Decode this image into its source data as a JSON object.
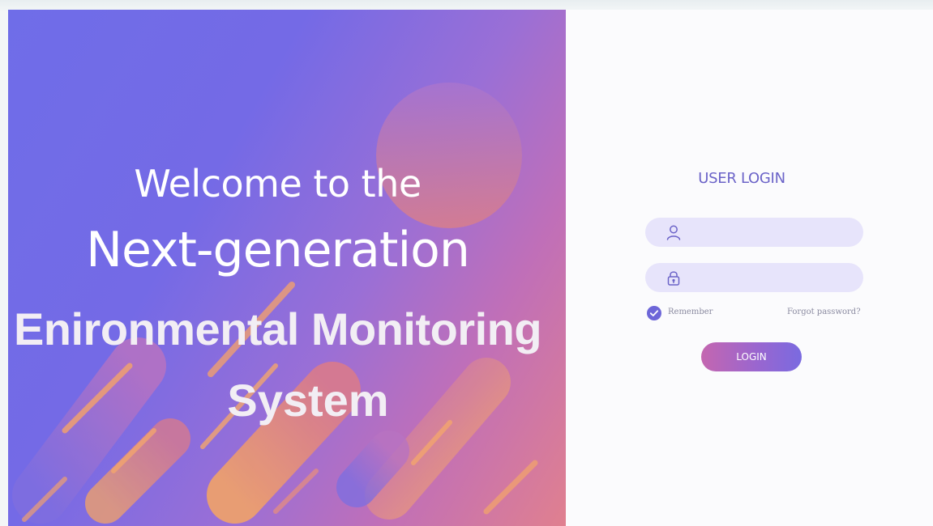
{
  "hero": {
    "line1": "Welcome to the",
    "line2": "Next-generation",
    "line3": "Enironmental Monitoring",
    "line4": "System"
  },
  "login": {
    "title": "USER LOGIN",
    "username": {
      "value": "",
      "placeholder": "",
      "icon": "user-icon"
    },
    "password": {
      "value": "",
      "placeholder": "",
      "icon": "lock-icon"
    },
    "remember_label": "Remember",
    "remember_checked": true,
    "forgot_label": "Forgot password?",
    "submit_label": "LOGIN"
  },
  "colors": {
    "accent": "#6b63c8",
    "field_bg": "#e7e4fb",
    "hero_start": "#6f6de8",
    "hero_end": "#e0808f"
  }
}
